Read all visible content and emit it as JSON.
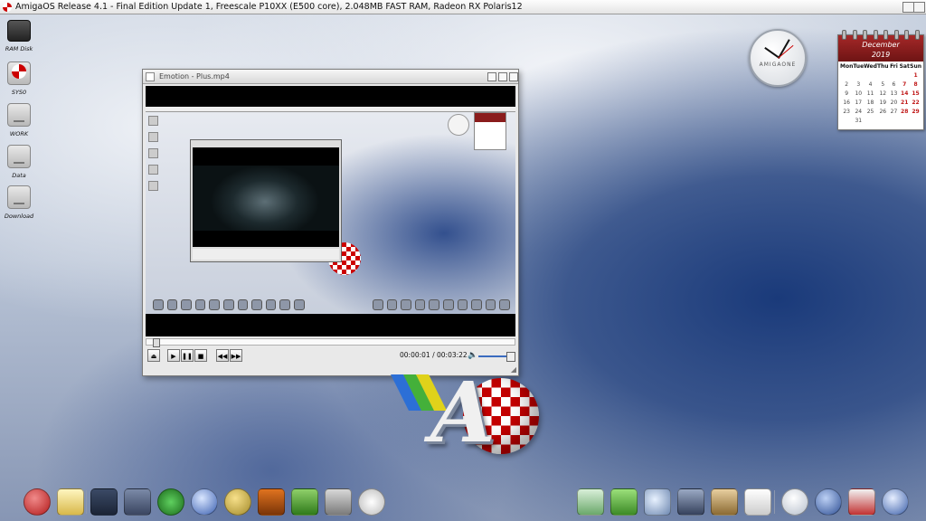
{
  "screen": {
    "title": "AmigaOS Release 4.1 - Final Edition Update 1, Freescale P10XX (E500 core), 2.048MB FAST RAM, Radeon RX Polaris12"
  },
  "desktop_icons": [
    {
      "label": "RAM Disk",
      "icon": "ram-disk-icon"
    },
    {
      "label": "SYS0",
      "icon": "boing-drive-icon"
    },
    {
      "label": "WORK",
      "icon": "harddisk-icon"
    },
    {
      "label": "Data",
      "icon": "harddisk-icon"
    },
    {
      "label": "Download",
      "icon": "harddisk-icon"
    }
  ],
  "clock": {
    "brand": "AMIGAONE"
  },
  "calendar": {
    "month": "December",
    "year": "2019",
    "weekdays": [
      "Mon",
      "Tue",
      "Wed",
      "Thu",
      "Fri",
      "Sat",
      "Sun"
    ],
    "rows": [
      [
        "",
        "",
        "",
        "",
        "",
        "",
        "1"
      ],
      [
        "2",
        "3",
        "4",
        "5",
        "6",
        "7",
        "8"
      ],
      [
        "9",
        "10",
        "11",
        "12",
        "13",
        "14",
        "15"
      ],
      [
        "16",
        "17",
        "18",
        "19",
        "20",
        "21",
        "22"
      ],
      [
        "23",
        "24",
        "25",
        "26",
        "27",
        "28",
        "29"
      ],
      [
        "",
        "31",
        "",
        "",
        "",
        "",
        ""
      ]
    ]
  },
  "player": {
    "title": "Emotion - Plus.mp4",
    "elapsed": "00:00:01",
    "total": "00:03:22",
    "time_separator": "/",
    "progress_fraction": 0.005,
    "volume_fraction": 0.9
  },
  "dock": {
    "left": [
      "boing-icon",
      "prefs-icon",
      "screenmode-icon",
      "monitor-icon",
      "download-icon",
      "globe-icon",
      "ibrowse-icon",
      "video-icon",
      "notepad-icon",
      "camera-icon",
      "clock-icon"
    ],
    "right": [
      "install-icon",
      "editor-icon",
      "search-icon",
      "shell-icon",
      "archive-icon",
      "pdf-icon",
      "lightbulb-icon",
      "shutdown-icon",
      "gift-icon",
      "navigation-icon"
    ]
  },
  "colors": {
    "accent_red": "#c40000",
    "calendar_header": "#8a1c1c",
    "volume_blue": "#3a6bbf"
  }
}
